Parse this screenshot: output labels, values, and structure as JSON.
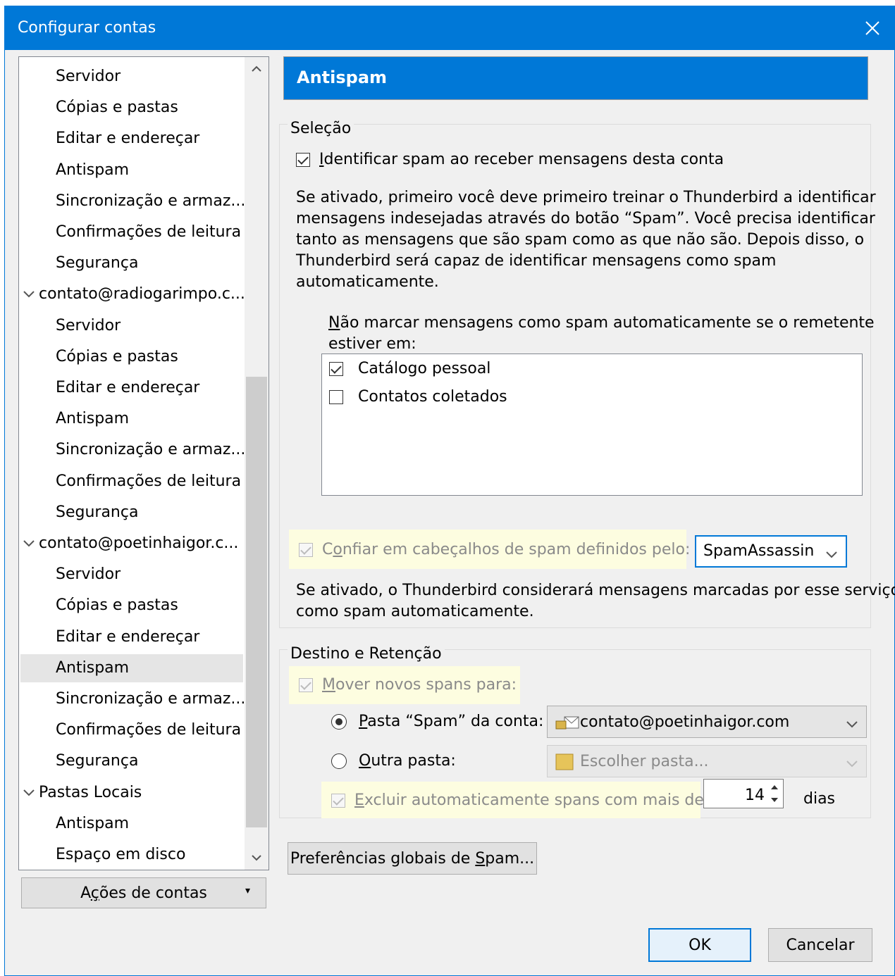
{
  "window": {
    "title": "Configurar contas"
  },
  "tree": {
    "items": [
      {
        "label": "Servidor",
        "kind": "child"
      },
      {
        "label": "Cópias e pastas",
        "kind": "child"
      },
      {
        "label": "Editar e endereçar",
        "kind": "child"
      },
      {
        "label": "Antispam",
        "kind": "child"
      },
      {
        "label": "Sincronização e armaz...",
        "kind": "child"
      },
      {
        "label": "Confirmações de leitura",
        "kind": "child"
      },
      {
        "label": "Segurança",
        "kind": "child"
      },
      {
        "label": "contato@radiogarimpo.c...",
        "kind": "parent"
      },
      {
        "label": "Servidor",
        "kind": "child"
      },
      {
        "label": "Cópias e pastas",
        "kind": "child"
      },
      {
        "label": "Editar e endereçar",
        "kind": "child"
      },
      {
        "label": "Antispam",
        "kind": "child"
      },
      {
        "label": "Sincronização e armaz...",
        "kind": "child"
      },
      {
        "label": "Confirmações de leitura",
        "kind": "child"
      },
      {
        "label": "Segurança",
        "kind": "child"
      },
      {
        "label": "contato@poetinhaigor.c...",
        "kind": "parent"
      },
      {
        "label": "Servidor",
        "kind": "child"
      },
      {
        "label": "Cópias e pastas",
        "kind": "child"
      },
      {
        "label": "Editar e endereçar",
        "kind": "child"
      },
      {
        "label": "Antispam",
        "kind": "child",
        "selected": true
      },
      {
        "label": "Sincronização e armaz...",
        "kind": "child"
      },
      {
        "label": "Confirmações de leitura",
        "kind": "child"
      },
      {
        "label": "Segurança",
        "kind": "child"
      },
      {
        "label": "Pastas Locais",
        "kind": "parent"
      },
      {
        "label": "Antispam",
        "kind": "child"
      },
      {
        "label": "Espaço em disco",
        "kind": "child"
      }
    ]
  },
  "account_actions": {
    "label_pre": "A",
    "label_u": "ç",
    "label_post": "ões de contas"
  },
  "panel": {
    "title": "Antispam",
    "selection": {
      "legend": "Seleção",
      "identify": {
        "u": "I",
        "rest": "dentificar spam ao receber mensagens desta conta",
        "checked": true
      },
      "description": [
        "Se ativado, primeiro você deve primeiro treinar o Thunderbird a identificar",
        "mensagens indesejadas através do botão “Spam”. Você precisa identificar",
        "tanto as mensagens que são spam como as que não são. Depois disso, o",
        "Thunderbird será capaz de identificar mensagens como spam",
        "automaticamente."
      ],
      "whitelist_label_u": "N",
      "whitelist_label_rest1": "ão marcar mensagens como spam automaticamente se o remetente",
      "whitelist_label_line2": "estiver em:",
      "whitelist": [
        {
          "label": "Catálogo pessoal",
          "checked": true
        },
        {
          "label": "Contatos coletados",
          "checked": false
        }
      ],
      "trust": {
        "pre": "C",
        "u": "o",
        "rest": "nfiar em cabeçalhos de spam definidos pelo:",
        "checked": true
      },
      "trust_select": "SpamAssassin",
      "trust_note": [
        "Se ativado, o Thunderbird considerará mensagens marcadas por esse serviço",
        "como spam automaticamente."
      ]
    },
    "destination": {
      "legend": "Destino e Retenção",
      "move": {
        "u": "M",
        "rest": "over novos spans para:",
        "checked": true
      },
      "account_folder": {
        "u": "P",
        "rest": "asta “Spam” da conta:",
        "selected": true
      },
      "account_folder_value": "contato@poetinhaigor.com",
      "other_folder": {
        "u": "O",
        "rest": "utra pasta:",
        "selected": false
      },
      "other_folder_value": "Escolher pasta...",
      "purge": {
        "u": "E",
        "rest": "xcluir automaticamente spans com mais de",
        "checked": true
      },
      "purge_days": "14",
      "days_label": "dias"
    },
    "global_prefs": {
      "pre": "Preferências globais de ",
      "u": "S",
      "post": "pam..."
    }
  },
  "footer": {
    "ok": "OK",
    "cancel": "Cancelar"
  }
}
